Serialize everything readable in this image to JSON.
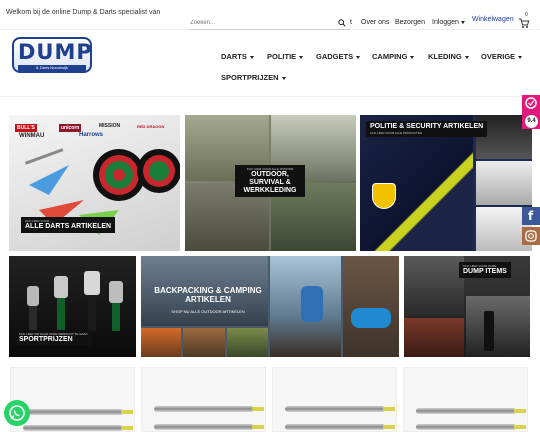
{
  "topbar": {
    "welcome": "Welkom bij de online Dump & Darts specialist van",
    "search_placeholder": "Zoeken...",
    "search_extra": "t",
    "links": [
      "Over ons",
      "Bezorgen",
      "Inloggen"
    ],
    "cart_label": "Winkelwagen",
    "cart_count": "0"
  },
  "logo": {
    "main": "DUMP",
    "sub": "& Darts Noordwijk"
  },
  "nav": [
    "DARTS",
    "POLITIE",
    "GADGETS",
    "CAMPING",
    "KLEDING",
    "OVERIGE",
    "SPORTPRIJZEN"
  ],
  "side": {
    "rating": "9.4"
  },
  "tiles": {
    "darts_small": "KLIK HIER VOOR",
    "darts": "ALLE DARTS ARTIKELEN",
    "outdoor_small": "KLIK HIER VOOR ALLE OUDOOR",
    "outdoor": "OUTDOOR, SURVIVAL & WERKKLEDING",
    "politie_small": "KLIK HIER VOOR ALLE PRODUCTEN",
    "politie": "POLITIE & SECURITY ARTIKELEN",
    "sport_small": "KLIK HIER OM NAAR ONZE WEBSHOP TE GAAN",
    "sport": "SPORTPRIJZEN",
    "backpacking": "BACKPACKING & CAMPING ARTIKELEN",
    "backpacking_small": "SHOP NU ALLE OUTDOOR ARTIKELEN",
    "dump_small": "KLIK HIER VOOR ONZE",
    "dump": "DUMP ITEMS",
    "brands": [
      "BULL'S",
      "unicorn",
      "WINMAU",
      "Harrows",
      "MISSION",
      "RED DRAGON"
    ]
  },
  "colors": {
    "accent": "#1f3fa8",
    "brand": "#1f3f8f",
    "whatsapp": "#25d366",
    "instagram": "#e1306c",
    "facebook": "#3b5998"
  }
}
